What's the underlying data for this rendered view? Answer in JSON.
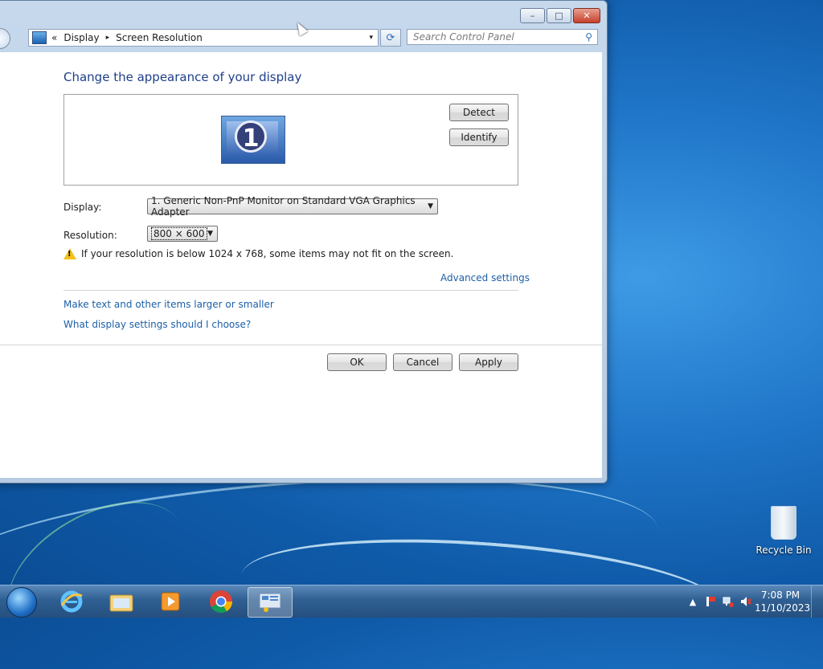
{
  "window": {
    "address": {
      "chevrons": "«",
      "crumbs": [
        "Display",
        "Screen Resolution"
      ],
      "sep": "▸",
      "dropdown": "▾"
    },
    "refresh_symbol": "⟳",
    "search": {
      "placeholder": "Search Control Panel",
      "icon": "⚲"
    },
    "title_buttons": {
      "minimize": "–",
      "maximize": "□",
      "close": "✕"
    }
  },
  "content": {
    "heading": "Change the appearance of your display",
    "monitor_number": "1",
    "detect_button": "Detect",
    "identify_button": "Identify",
    "display_label": "Display:",
    "display_value": "1. Generic Non-PnP Monitor on Standard VGA Graphics Adapter",
    "resolution_label": "Resolution:",
    "resolution_value": "800 × 600",
    "dropdown_arrow": "▼",
    "warning_text": "If your resolution is below 1024 x 768, some items may not fit on the screen.",
    "warning_mark": "!",
    "advanced_link": "Advanced settings",
    "link_text_size": "Make text and other items larger or smaller",
    "link_choose": "What display settings should I choose?",
    "ok_button": "OK",
    "cancel_button": "Cancel",
    "apply_button": "Apply"
  },
  "desktop": {
    "recycle_bin": "Recycle Bin"
  },
  "taskbar": {
    "apps": [
      "start-orb",
      "internet-explorer-icon",
      "file-explorer-icon",
      "media-player-icon",
      "chrome-icon",
      "control-panel-icon"
    ],
    "tray_up": "▲",
    "time": "7:08 PM",
    "date": "11/10/2023"
  },
  "colors": {
    "accent": "#1e3f8a",
    "link": "#1c5fa8",
    "warning": "#f2c21b"
  }
}
